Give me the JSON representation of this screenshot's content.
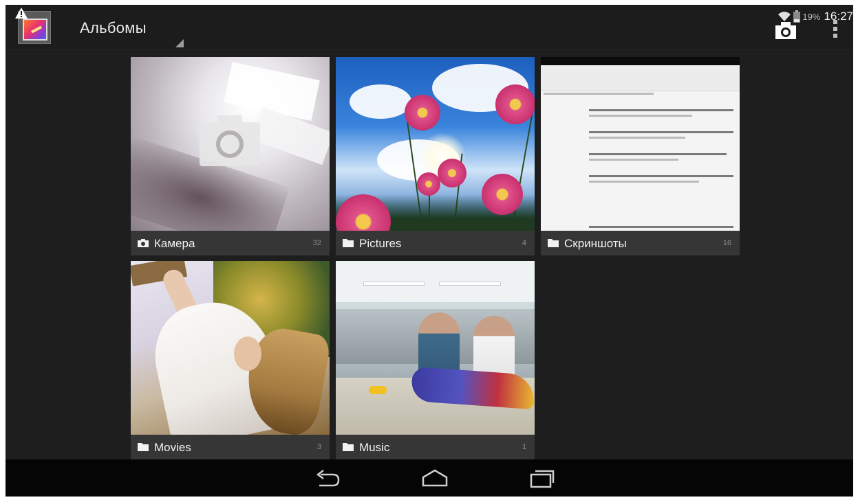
{
  "action_bar": {
    "title": "Альбомы",
    "app_icon": "gallery-icon",
    "warning_icon": "warning-icon",
    "camera_icon": "camera-icon",
    "overflow_icon": "overflow-menu-icon"
  },
  "status_bar": {
    "wifi_icon": "wifi-icon",
    "battery_icon": "battery-icon",
    "battery_percent": "19%",
    "time": "16:27"
  },
  "albums": [
    {
      "name": "Камера",
      "count": "32",
      "icon": "camera-icon"
    },
    {
      "name": "Pictures",
      "count": "4",
      "icon": "folder-icon"
    },
    {
      "name": "Скриншоты",
      "count": "16",
      "icon": "folder-icon"
    },
    {
      "name": "Movies",
      "count": "3",
      "icon": "folder-icon"
    },
    {
      "name": "Music",
      "count": "1",
      "icon": "folder-icon"
    }
  ],
  "nav_bar": {
    "back_icon": "back-icon",
    "home_icon": "home-icon",
    "recents_icon": "recent-apps-icon"
  },
  "colors": {
    "background": "#1e1e1e",
    "action_bar": "#1c1c1c",
    "label_bar": "#363636",
    "nav_bar": "#050505"
  }
}
